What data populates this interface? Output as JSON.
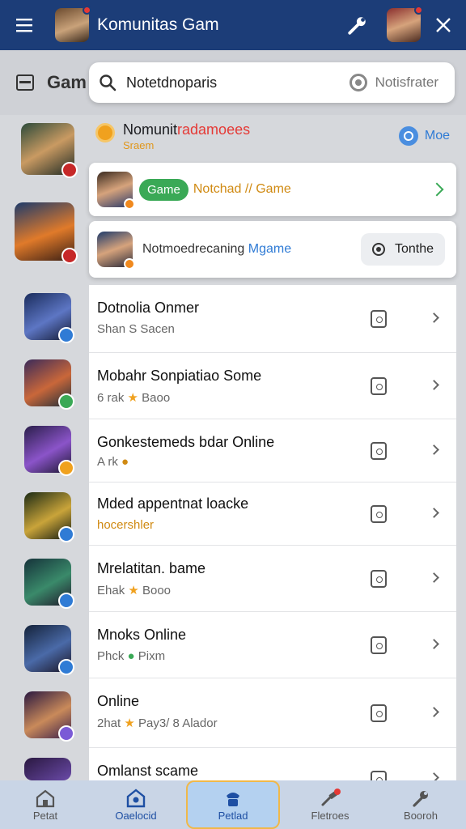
{
  "appbar": {
    "title": "Komunitas Gam"
  },
  "background": {
    "title": "Gam"
  },
  "search": {
    "query": "Notetdnoparis",
    "right_label": "Notisfrater"
  },
  "notification": {
    "title_dark": "Nomunit",
    "title_red": "radamoees",
    "subtitle": "Sraem",
    "more_label": "Moe"
  },
  "feature_cards": [
    {
      "pill": "Game",
      "text": "Notchad // Game"
    },
    {
      "text_main": "Notmoedrecaning ",
      "text_highlight": "Mgame",
      "button": "Tonthe"
    }
  ],
  "list": [
    {
      "title": "Dotnolia Onmer",
      "sub": "Shan S Sacen"
    },
    {
      "title": "Mobahr Sonpiatiao Some",
      "sub_a": "6 rak ",
      "sub_star": "★",
      "sub_b": " Baoo"
    },
    {
      "title": "Gonkestemeds bdar Online",
      "sub_a": "A rk ",
      "sub_warm": "●"
    },
    {
      "title": "Mded appentnat loacke",
      "sub_warm": "hocershler"
    },
    {
      "title": "Mrelatitan. bame",
      "sub_a": "Ehak ",
      "sub_star": "★",
      "sub_b": " Booo"
    },
    {
      "title": "Mnoks Online",
      "sub_a": "Phck ",
      "sub_green": "●",
      "sub_b": " Pixm"
    },
    {
      "title": "Online",
      "sub_a": "2hat ",
      "sub_star": "★",
      "sub_b": " Pay3/ 8 Alador"
    },
    {
      "title": "Omlanst scame",
      "sub": ""
    }
  ],
  "bottomnav": [
    {
      "label": "Petat"
    },
    {
      "label": "Oaelocid"
    },
    {
      "label": "Petlad"
    },
    {
      "label": "Fletroes"
    },
    {
      "label": "Booroh"
    }
  ],
  "colors": {
    "appbar": "#1c3d78",
    "accent_blue": "#2f7bd5",
    "green": "#3aa956",
    "orange": "#f0a11e",
    "red": "#e53935"
  }
}
